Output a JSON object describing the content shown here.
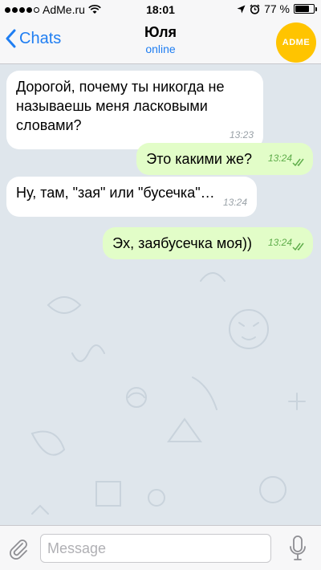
{
  "status_bar": {
    "carrier": "AdMe.ru",
    "time": "18:01",
    "battery": "77 %",
    "battery_level": 0.77,
    "signal_bars": 4,
    "icons": [
      "signal-icon",
      "wifi-icon",
      "location-icon",
      "alarm-icon",
      "battery-icon"
    ]
  },
  "nav": {
    "back_label": "Chats",
    "contact_name": "Юля",
    "contact_status": "online",
    "avatar_text": "ADME",
    "accent_color": "#1f7ef2",
    "avatar_color": "#ffc400"
  },
  "messages": [
    {
      "direction": "in",
      "text": "Дорогой, почему ты никогда не называешь меня ласковыми словами?",
      "time": "13:23"
    },
    {
      "direction": "out",
      "text": "Это какими же?",
      "time": "13:24",
      "read": true
    },
    {
      "direction": "in",
      "text": "Ну, там, \"зая\" или \"бусечка\"…",
      "time": "13:24"
    },
    {
      "direction": "out",
      "text": "Эх, заябусечка моя))",
      "time": "13:24",
      "read": true
    }
  ],
  "input": {
    "placeholder": "Message",
    "value": ""
  },
  "colors": {
    "chat_background": "#dfe6ec",
    "incoming_bubble": "#ffffff",
    "outgoing_bubble": "#e2fdc8",
    "outgoing_time": "#5fad4b"
  }
}
